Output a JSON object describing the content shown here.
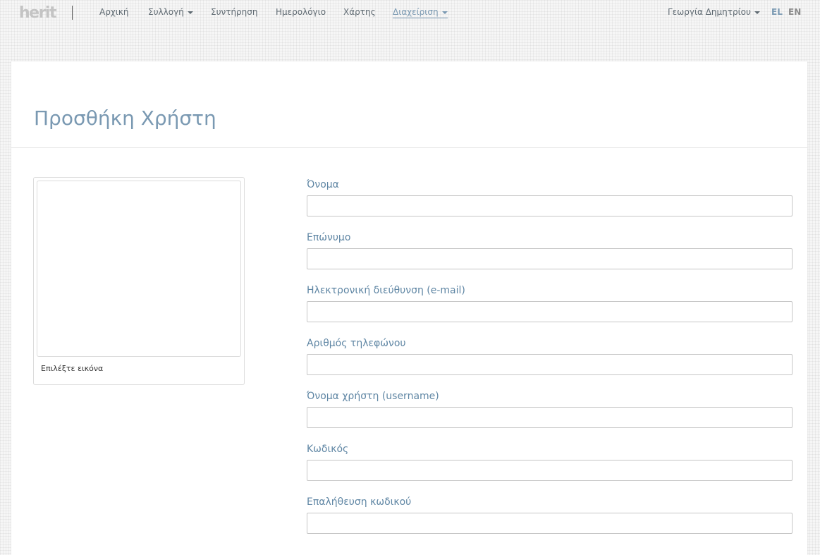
{
  "logo": {
    "text": "herit"
  },
  "nav": {
    "home": "Αρχική",
    "collection": "Συλλογή",
    "maintenance": "Συντήρηση",
    "calendar": "Ημερολόγιο",
    "map": "Χάρτης",
    "admin": "Διαχείριση"
  },
  "user": {
    "name": "Γεωργία Δημητρίου"
  },
  "lang": {
    "el": "EL",
    "en": "EN"
  },
  "colors": {
    "accent": "#7a99b2",
    "label": "#5f86a4",
    "nav": "#5f6a72"
  },
  "page": {
    "title": "Προσθήκη Χρήστη"
  },
  "image_card": {
    "caption": "Επιλέξτε εικόνα"
  },
  "form": {
    "first_name": {
      "label": "Όνομα",
      "value": ""
    },
    "last_name": {
      "label": "Επώνυμο",
      "value": ""
    },
    "email": {
      "label": "Ηλεκτρονική διεύθυνση (e-mail)",
      "value": ""
    },
    "phone": {
      "label": "Αριθμός τηλεφώνου",
      "value": ""
    },
    "username": {
      "label": "Όνομα χρήστη (username)",
      "value": ""
    },
    "password": {
      "label": "Κωδικός",
      "value": ""
    },
    "password_confirm": {
      "label": "Επαλήθευση κωδικού",
      "value": ""
    }
  }
}
